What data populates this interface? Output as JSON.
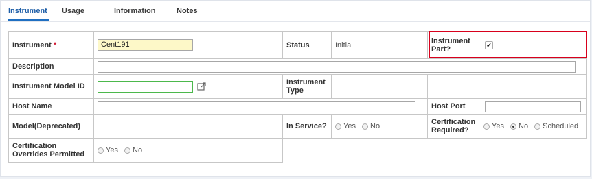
{
  "tabs": [
    "Instrument",
    "Usage",
    "Information",
    "Notes"
  ],
  "form": {
    "instrument_label": "Instrument",
    "required_mark": "*",
    "instrument_value": "Cent191",
    "status_label": "Status",
    "status_value": "Initial",
    "instrument_part_label": "Instrument Part?",
    "instrument_part_checked": "✔",
    "description_label": "Description",
    "description_value": "",
    "model_id_label": "Instrument Model ID",
    "model_id_value": "",
    "instrument_type_label": "Instrument Type",
    "host_name_label": "Host Name",
    "host_name_value": "",
    "host_port_label": "Host Port",
    "host_port_value": "",
    "model_deprecated_label": "Model(Deprecated)",
    "model_deprecated_value": "",
    "in_service_label": "In Service?",
    "in_service_options": [
      "Yes",
      "No"
    ],
    "certification_required_label": "Certification Required?",
    "certification_required_options": [
      "Yes",
      "No",
      "Scheduled"
    ],
    "certification_required_selected": "No",
    "overrides_label": "Certification Overrides Permitted",
    "overrides_options": [
      "Yes",
      "No"
    ]
  },
  "colors": {
    "highlight": "#d8001c",
    "active_tab": "#1f5fa8",
    "required": "#d0142f",
    "instrument_field_bg": "#fdf8c8",
    "model_id_border": "#4cb84c"
  },
  "icons": {
    "open_link": "external-link-icon",
    "checkbox": "checkbox-checked-icon"
  }
}
